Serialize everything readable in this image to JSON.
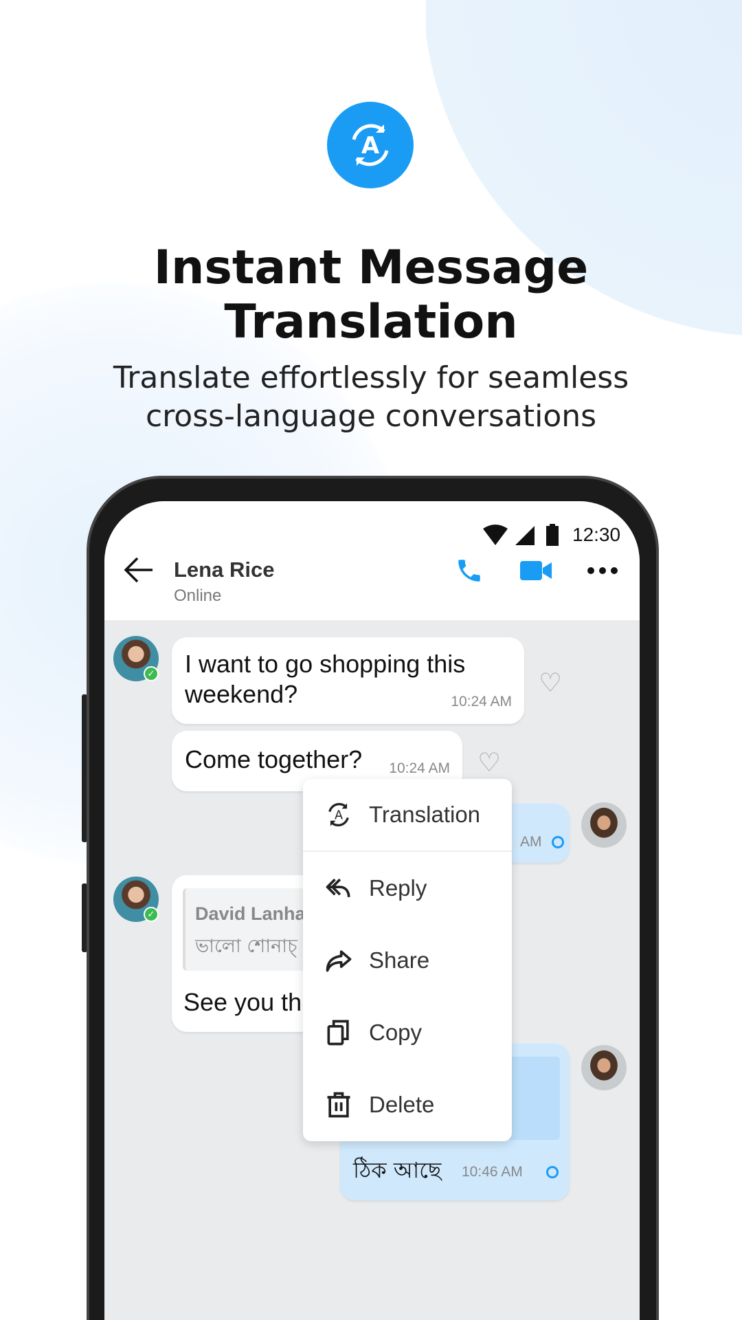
{
  "hero": {
    "icon": "translate-icon",
    "title_line1": "Instant Message",
    "title_line2": "Translation",
    "subtitle_line1": "Translate effortlessly for seamless",
    "subtitle_line2": "cross-language conversations"
  },
  "status_bar": {
    "time": "12:30",
    "icons": [
      "wifi-icon",
      "signal-icon",
      "battery-icon"
    ]
  },
  "header": {
    "name": "Lena Rice",
    "status": "Online",
    "icons": [
      "back-arrow-icon",
      "phone-icon",
      "video-icon",
      "more-icon"
    ]
  },
  "colors": {
    "accent": "#1a9cf5",
    "chat_bg": "#e9ebed",
    "outgoing_bubble": "#cfe8fc",
    "online_badge": "#3cbb52"
  },
  "messages": [
    {
      "side": "incoming",
      "text_line1": "I want to go shopping this",
      "text_line2": "weekend?",
      "time": "10:24 AM"
    },
    {
      "side": "incoming",
      "text": "Come together?",
      "time": "10:24 AM"
    },
    {
      "side": "outgoing",
      "time": "AM"
    },
    {
      "side": "incoming",
      "quote_author": "David Lanha",
      "quote_text": "ভালো শোনাচ্",
      "text": "See you th"
    },
    {
      "side": "outgoing",
      "text": "ঠিক আছে",
      "time": "10:46 AM"
    }
  ],
  "context_menu": {
    "items": [
      {
        "label": "Translation",
        "icon": "translate-icon"
      },
      {
        "label": "Reply",
        "icon": "reply-icon"
      },
      {
        "label": "Share",
        "icon": "share-icon"
      },
      {
        "label": "Copy",
        "icon": "copy-icon"
      },
      {
        "label": "Delete",
        "icon": "trash-icon"
      }
    ]
  }
}
